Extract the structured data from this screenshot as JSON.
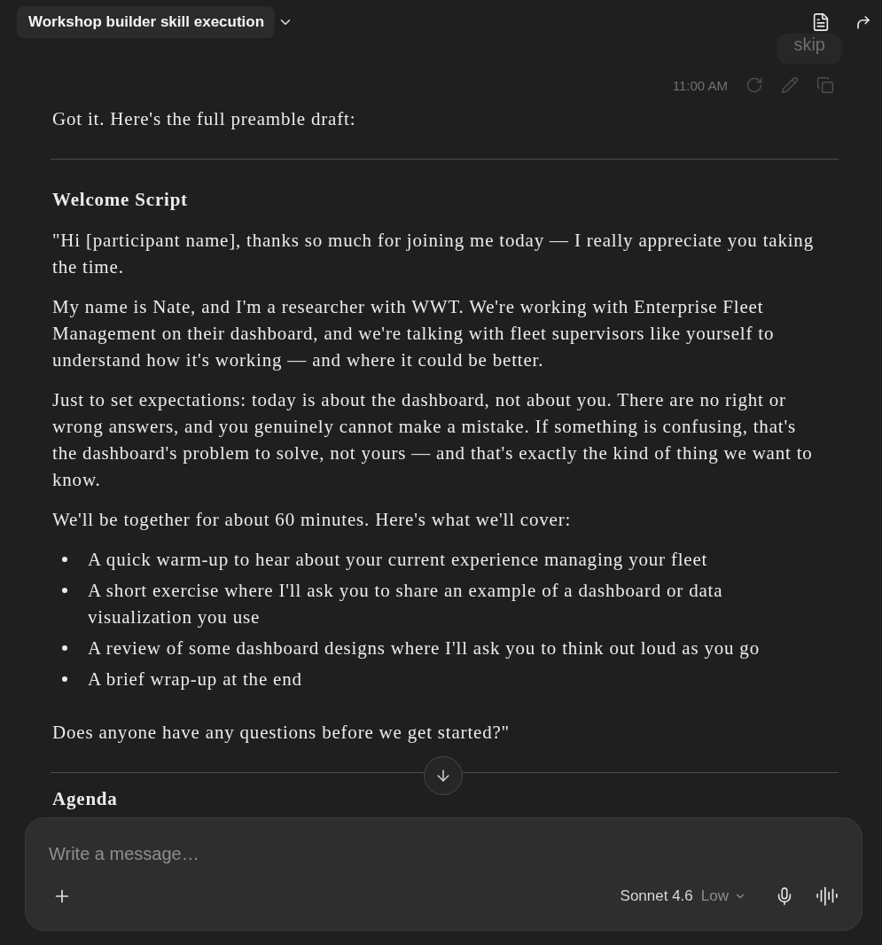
{
  "header": {
    "title": "Workshop builder skill execution"
  },
  "previous_message": {
    "skip_button": "skip"
  },
  "message_actions": {
    "time": "11:00 AM"
  },
  "response": {
    "blocks": [
      {
        "kind": "paragraph",
        "text": "Got it. Here's the full preamble draft:"
      },
      {
        "kind": "divider"
      },
      {
        "kind": "heading",
        "text": "Welcome Script"
      },
      {
        "kind": "paragraph",
        "text": "\"Hi [participant name], thanks so much for joining me today — I really appreciate you taking the time."
      },
      {
        "kind": "paragraph",
        "text": "My name is Nate, and I'm a researcher with WWT. We're working with Enterprise Fleet Management on their dashboard, and we're talking with fleet supervisors like yourself to understand how it's working — and where it could be better."
      },
      {
        "kind": "paragraph",
        "text": "Just to set expectations: today is about the dashboard, not about you. There are no right or wrong answers, and you genuinely cannot make a mistake. If something is confusing, that's the dashboard's problem to solve, not yours — and that's exactly the kind of thing we want to know."
      },
      {
        "kind": "paragraph",
        "text": "We'll be together for about 60 minutes. Here's what we'll cover:"
      },
      {
        "kind": "list",
        "items": [
          "A quick warm-up to hear about your current experience managing your fleet",
          "A short exercise where I'll ask you to share an example of a dashboard or data visualization you use",
          "A review of some dashboard designs where I'll ask you to think out loud as you go",
          "A brief wrap-up at the end"
        ]
      },
      {
        "kind": "paragraph",
        "text": "Does anyone have any questions before we get started?\""
      },
      {
        "kind": "divider"
      },
      {
        "kind": "heading",
        "text": "Agenda"
      }
    ]
  },
  "composer": {
    "placeholder": "Write a message…",
    "model": "Sonnet 4.6",
    "effort": "Low"
  }
}
